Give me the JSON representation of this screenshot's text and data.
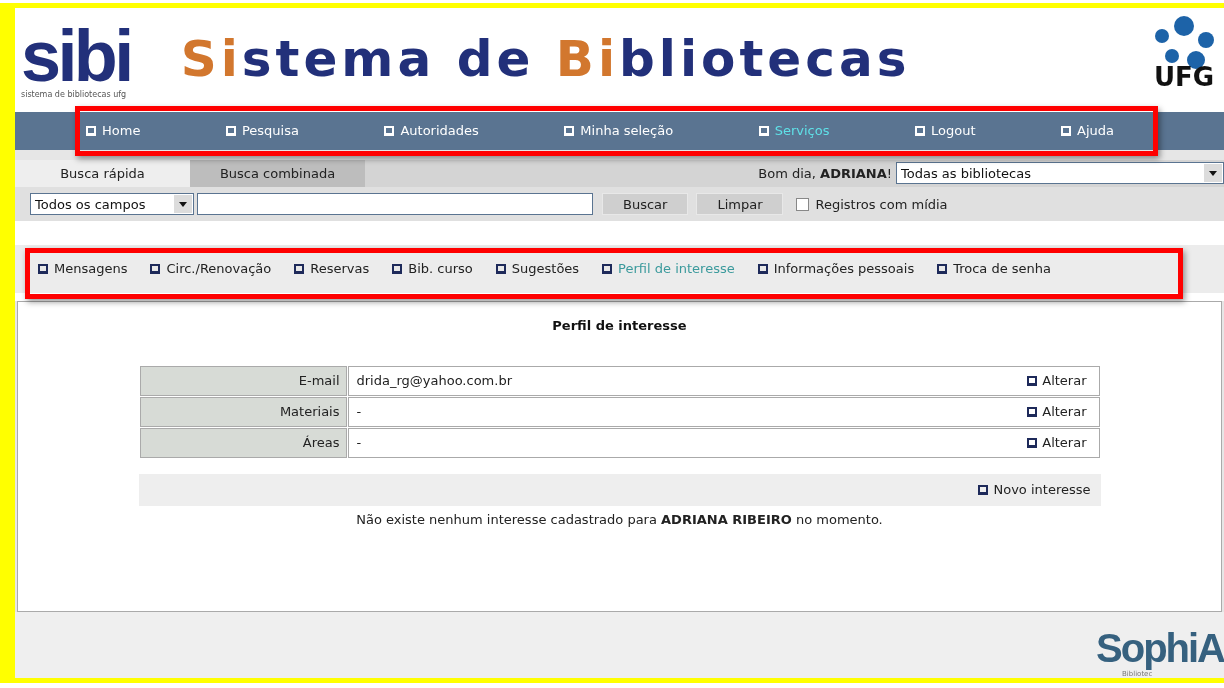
{
  "header": {
    "logo_text": "sibi",
    "logo_caption": "sistema de bibliotecas ufg",
    "title": "Sistema de Bibliotecas",
    "emblem_text": "UFG"
  },
  "nav": [
    {
      "label": "Home",
      "selected": false
    },
    {
      "label": "Pesquisa",
      "selected": false
    },
    {
      "label": "Autoridades",
      "selected": false
    },
    {
      "label": "Minha seleção",
      "selected": false
    },
    {
      "label": "Serviços",
      "selected": true
    },
    {
      "label": "Logout",
      "selected": false
    },
    {
      "label": "Ajuda",
      "selected": false
    }
  ],
  "search_tabs": [
    {
      "label": "Busca rápida",
      "selected": true
    },
    {
      "label": "Busca combinada",
      "selected": false
    }
  ],
  "greeting": "Bom dia, **ADRIANA**!",
  "library_select": {
    "value": "Todas as bibliotecas"
  },
  "field_select": {
    "value": "Todos os campos"
  },
  "search_buttons": [
    "Buscar",
    "Limpar"
  ],
  "media_checkbox": {
    "label": "Registros com mídia",
    "checked": false
  },
  "service_menu": [
    {
      "label": "Mensagens",
      "selected": false
    },
    {
      "label": "Circ./Renovação",
      "selected": false
    },
    {
      "label": "Reservas",
      "selected": false
    },
    {
      "label": "Bib. curso",
      "selected": false
    },
    {
      "label": "Sugestões",
      "selected": false
    },
    {
      "label": "Perfil de interesse",
      "selected": true
    },
    {
      "label": "Informações pessoais",
      "selected": false
    },
    {
      "label": "Troca de senha",
      "selected": false
    }
  ],
  "profile": {
    "title": "Perfil de interesse",
    "rows": [
      {
        "label": "E-mail",
        "value": "drida_rg@yahoo.com.br",
        "action": "Alterar"
      },
      {
        "label": "Materiais",
        "value": "-",
        "action": "Alterar"
      },
      {
        "label": "Áreas",
        "value": "-",
        "action": "Alterar"
      }
    ],
    "new_action": "Novo interesse",
    "message": "Não existe nenhum interesse cadastrado para **ADRIANA RIBEIRO** no momento."
  },
  "footer": {
    "brand": "SophiA",
    "brand_caption": "Bibliotec"
  }
}
